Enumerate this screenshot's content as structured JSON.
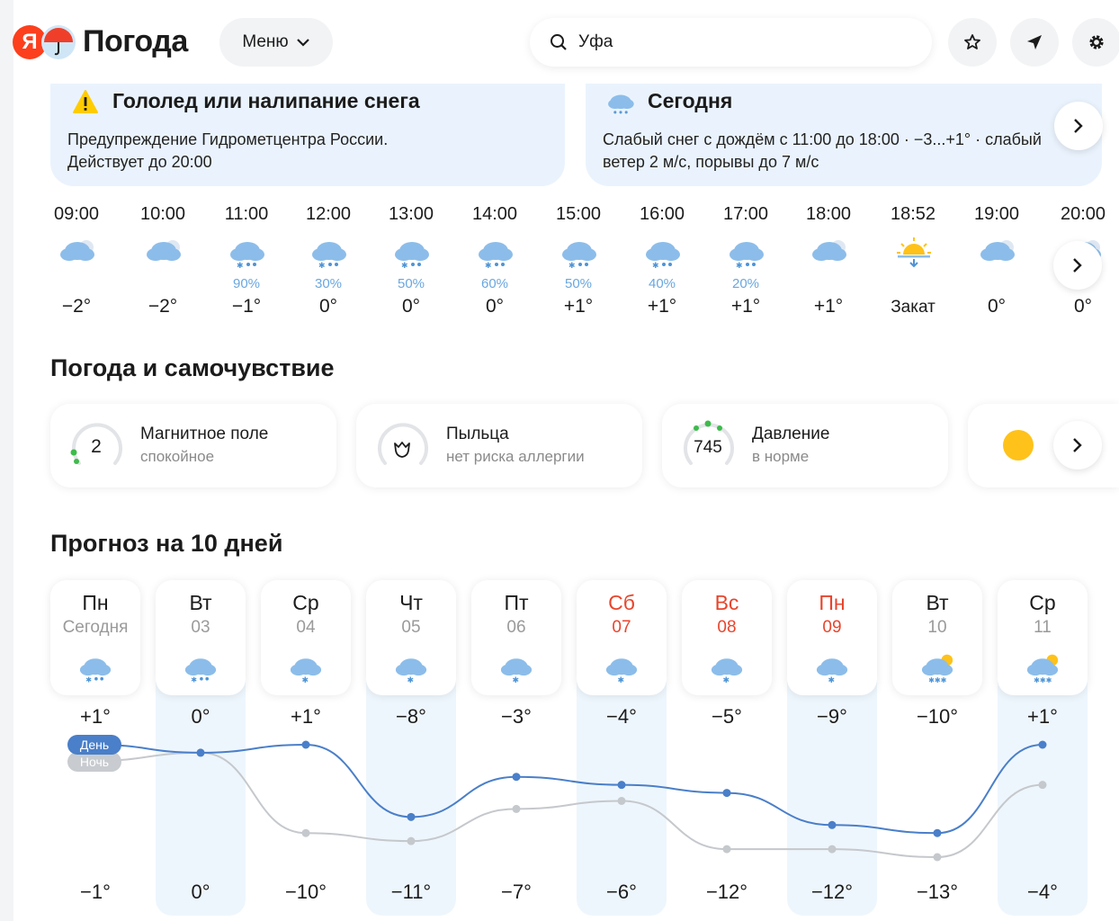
{
  "header": {
    "brand_letter": "Я",
    "brand_name": "Погода",
    "menu_label": "Меню",
    "search_value": "Уфа"
  },
  "alerts": [
    {
      "title": "Гололед или налипание снега",
      "line1": "Предупреждение Гидрометцентра России.",
      "line2": "Действует до 20:00"
    },
    {
      "title": "Сегодня",
      "line1": "Слабый снег с дождём с 11:00 до 18:00 · −3...+1° · слабый",
      "line2": "ветер 2 м/с, порывы до 7 м/с"
    }
  ],
  "hourly": [
    {
      "time": "09:00",
      "icon": "cloudy",
      "prob": "",
      "temp": "−2°"
    },
    {
      "time": "10:00",
      "icon": "cloudy",
      "prob": "",
      "temp": "−2°"
    },
    {
      "time": "11:00",
      "icon": "sleet",
      "prob": "90%",
      "temp": "−1°"
    },
    {
      "time": "12:00",
      "icon": "sleet",
      "prob": "30%",
      "temp": "0°"
    },
    {
      "time": "13:00",
      "icon": "sleet",
      "prob": "50%",
      "temp": "0°"
    },
    {
      "time": "14:00",
      "icon": "sleet",
      "prob": "60%",
      "temp": "0°"
    },
    {
      "time": "15:00",
      "icon": "sleet",
      "prob": "50%",
      "temp": "+1°"
    },
    {
      "time": "16:00",
      "icon": "sleet",
      "prob": "40%",
      "temp": "+1°"
    },
    {
      "time": "17:00",
      "icon": "sleet",
      "prob": "20%",
      "temp": "+1°"
    },
    {
      "time": "18:00",
      "icon": "cloudy",
      "prob": "",
      "temp": "+1°"
    },
    {
      "time": "18:52",
      "icon": "sunset",
      "prob": "",
      "temp": "Закат"
    },
    {
      "time": "19:00",
      "icon": "cloudy",
      "prob": "",
      "temp": "0°"
    },
    {
      "time": "20:00",
      "icon": "cloudy",
      "prob": "",
      "temp": "0°"
    }
  ],
  "wellbeing": {
    "title": "Погода и самочувствие",
    "cards": [
      {
        "value": "2",
        "title": "Магнитное поле",
        "sub": "спокойное"
      },
      {
        "value": "",
        "title": "Пыльца",
        "sub": "нет риска аллергии"
      },
      {
        "value": "745",
        "title": "Давление",
        "sub": "в норме"
      }
    ]
  },
  "forecast": {
    "title": "Прогноз на 10 дней",
    "day_label": "День",
    "night_label": "Ночь",
    "days": [
      {
        "name": "Пн",
        "date": "Сегодня",
        "icon": "sleet",
        "weekend": false,
        "max": "+1°",
        "min": "−1°"
      },
      {
        "name": "Вт",
        "date": "03",
        "icon": "sleet",
        "weekend": false,
        "max": "0°",
        "min": "0°"
      },
      {
        "name": "Ср",
        "date": "04",
        "icon": "snow",
        "weekend": false,
        "max": "+1°",
        "min": "−10°"
      },
      {
        "name": "Чт",
        "date": "05",
        "icon": "snow",
        "weekend": false,
        "max": "−8°",
        "min": "−11°"
      },
      {
        "name": "Пт",
        "date": "06",
        "icon": "snow",
        "weekend": false,
        "max": "−3°",
        "min": "−7°"
      },
      {
        "name": "Сб",
        "date": "07",
        "icon": "snow",
        "weekend": true,
        "max": "−4°",
        "min": "−6°"
      },
      {
        "name": "Вс",
        "date": "08",
        "icon": "snow",
        "weekend": true,
        "max": "−5°",
        "min": "−12°"
      },
      {
        "name": "Пн",
        "date": "09",
        "icon": "snow",
        "weekend": true,
        "max": "−9°",
        "min": "−12°"
      },
      {
        "name": "Вт",
        "date": "10",
        "icon": "snow-sun",
        "weekend": false,
        "max": "−10°",
        "min": "−13°"
      },
      {
        "name": "Ср",
        "date": "11",
        "icon": "snow-sun",
        "weekend": false,
        "max": "+1°",
        "min": "−4°"
      }
    ]
  },
  "chart_data": {
    "type": "line",
    "categories": [
      "Пн",
      "Вт",
      "Ср",
      "Чт",
      "Пт",
      "Сб",
      "Вс",
      "Пн",
      "Вт",
      "Ср"
    ],
    "series": [
      {
        "name": "День",
        "values": [
          1,
          0,
          1,
          -8,
          -3,
          -4,
          -5,
          -9,
          -10,
          1
        ],
        "color": "#4a7fc9"
      },
      {
        "name": "Ночь",
        "values": [
          -1,
          0,
          -10,
          -11,
          -7,
          -6,
          -12,
          -12,
          -13,
          -4
        ],
        "color": "#c5c8cc"
      }
    ],
    "ylim": [
      -13,
      1
    ]
  },
  "colors": {
    "accent": "#fc3f1d",
    "card_bg": "#eaf3fd",
    "rain": "#6aa7df",
    "weekend": "#e8452c"
  }
}
